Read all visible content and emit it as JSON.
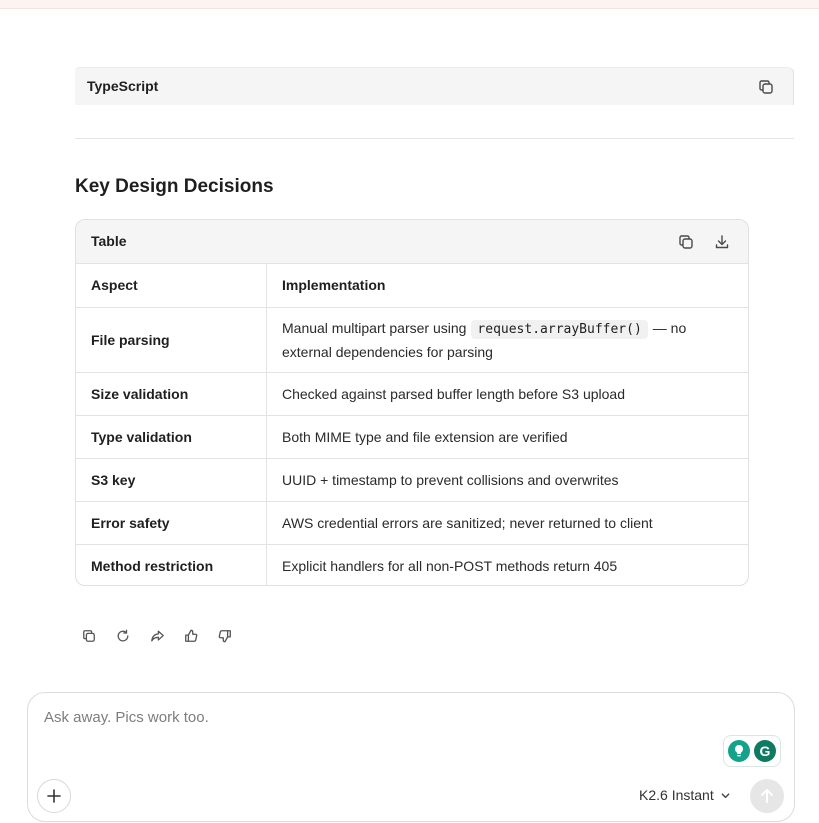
{
  "code_block": {
    "language": "TypeScript",
    "copy_icon": "copy-icon"
  },
  "section": {
    "heading": "Key Design Decisions"
  },
  "table": {
    "title": "Table",
    "copy_icon": "copy-icon",
    "download_icon": "download-icon",
    "headers": [
      "Aspect",
      "Implementation"
    ],
    "rows": [
      {
        "aspect": "File parsing",
        "impl_pre": "Manual multipart parser using",
        "impl_code": "request.arrayBuffer()",
        "impl_post": "— no external dependencies for parsing"
      },
      {
        "aspect": "Size validation",
        "impl": "Checked against parsed buffer length before S3 upload"
      },
      {
        "aspect": "Type validation",
        "impl": "Both MIME type and file extension are verified"
      },
      {
        "aspect": "S3 key",
        "impl": "UUID + timestamp to prevent collisions and overwrites"
      },
      {
        "aspect": "Error safety",
        "impl": "AWS credential errors are sanitized; never returned to client"
      },
      {
        "aspect": "Method restriction",
        "impl": "Explicit handlers for all non-POST methods return 405"
      }
    ]
  },
  "message_actions": [
    "copy-icon",
    "regenerate-icon",
    "share-icon",
    "thumbs-up-icon",
    "thumbs-down-icon"
  ],
  "composer": {
    "placeholder": "Ask away. Pics work too.",
    "model_label": "K2.6 Instant",
    "grammarly_icons": [
      "lightbulb-icon",
      "grammarly-icon"
    ],
    "grammarly_letter": "G",
    "colors": {
      "grammarly_green": "#15a28a",
      "grammarly_dark": "#0f7a62"
    }
  }
}
